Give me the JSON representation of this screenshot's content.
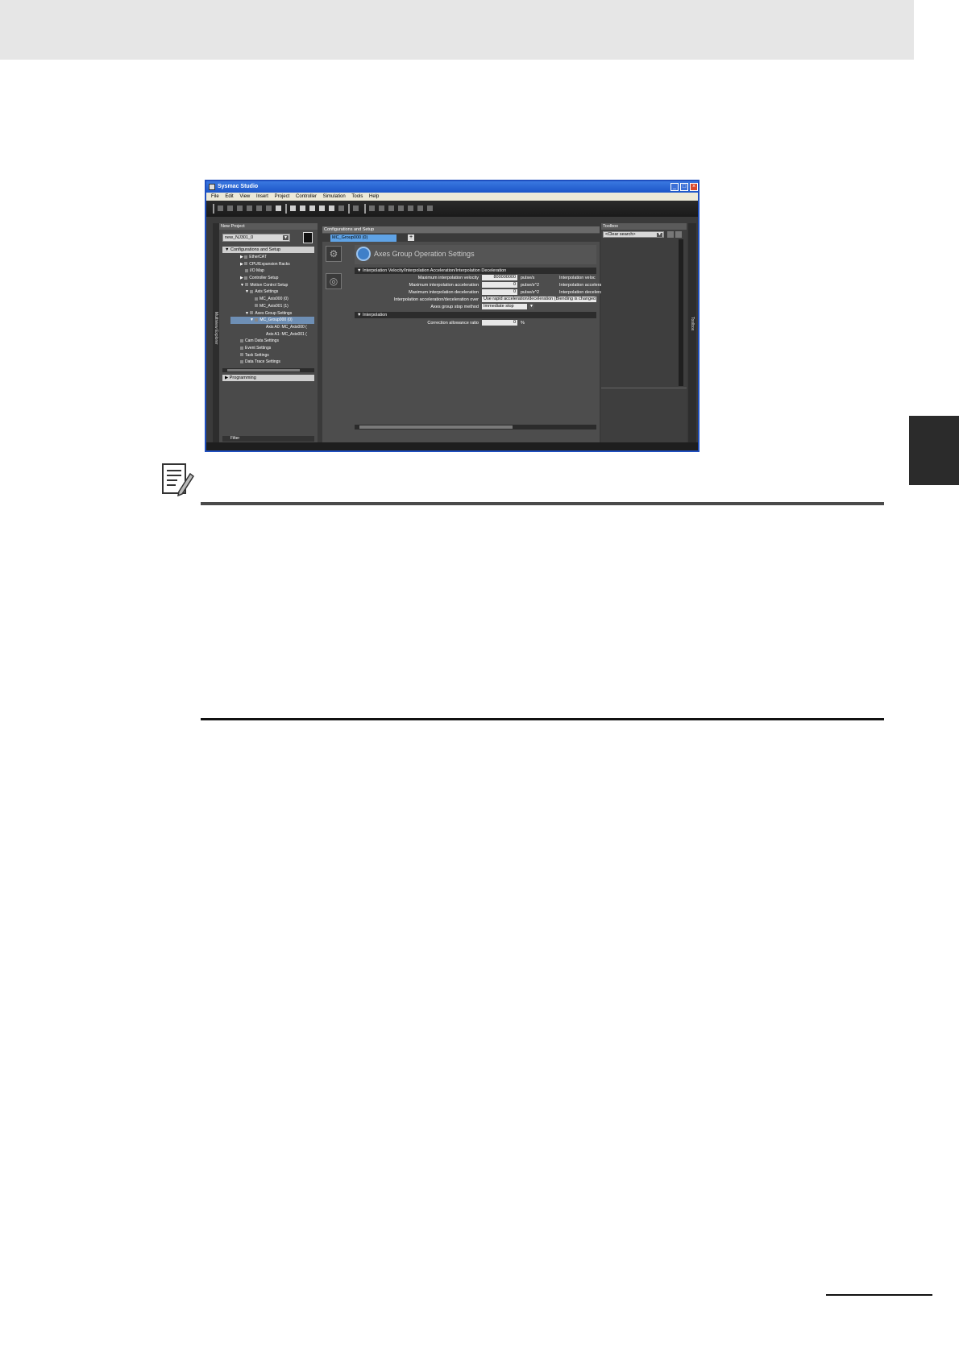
{
  "app": {
    "title": "Sysmac Studio",
    "menus": [
      "File",
      "Edit",
      "View",
      "Insert",
      "Project",
      "Controller",
      "Simulation",
      "Tools",
      "Help"
    ]
  },
  "explorer": {
    "header": "New Project",
    "device": "new_NJ301_0",
    "side_label": "Multiview Explorer",
    "tree_header": "Configurations and Setup",
    "items": [
      "EtherCAT",
      "CPU/Expansion Racks",
      "I/O Map",
      "Controller Setup",
      "Motion Control Setup",
      "Axis Settings",
      "MC_Axis000 (0)",
      "MC_Axis001 (1)",
      "Axes Group Settings",
      "MC_Group000 (0)",
      "Axis A0: MC_Axis000 (",
      "Axis A1: MC_Axis001 (",
      "Cam Data Settings",
      "Event Settings",
      "Task Settings",
      "Data Trace Settings"
    ],
    "programming": "Programming",
    "filter": "Filter"
  },
  "editor": {
    "pane_title": "Configurations and Setup",
    "tab": "MC_Group000 (0)",
    "heading": "Axes Group Operation Settings",
    "section1": "Interpolation Velocity/Interpolation Acceleration/Interpolation Deceleration",
    "rows": [
      {
        "label": "Maximum interpolation velocity",
        "value": "800000000",
        "unit": "pulse/s",
        "right": "Interpolation veloc"
      },
      {
        "label": "Maximum interpolation acceleration",
        "value": "0",
        "unit": "pulse/s^2",
        "right": "Interpolation accelerat"
      },
      {
        "label": "Maximum interpolation deceleration",
        "value": "0",
        "unit": "pulse/s^2",
        "right": "Interpolation decelerat"
      }
    ],
    "accel_over_label": "Interpolation acceleration/deceleration over",
    "accel_over_value": "Use rapid acceleration/deceleration (Blending is changed to",
    "stop_label": "Axes group stop method",
    "stop_value": "Immediate stop",
    "section2": "Interpolation",
    "corr_label": "Correction allowance ratio",
    "corr_value": "0",
    "corr_unit": "%"
  },
  "toolbox": {
    "header": "Toolbox",
    "search": "<Clear search>",
    "side_label": "Toolbox"
  },
  "colors": {
    "header_band": "#e6e6e6",
    "side_tab": "#2b2b2b",
    "tab_active": "#5fa3e6",
    "selection": "#6e8fb5"
  }
}
